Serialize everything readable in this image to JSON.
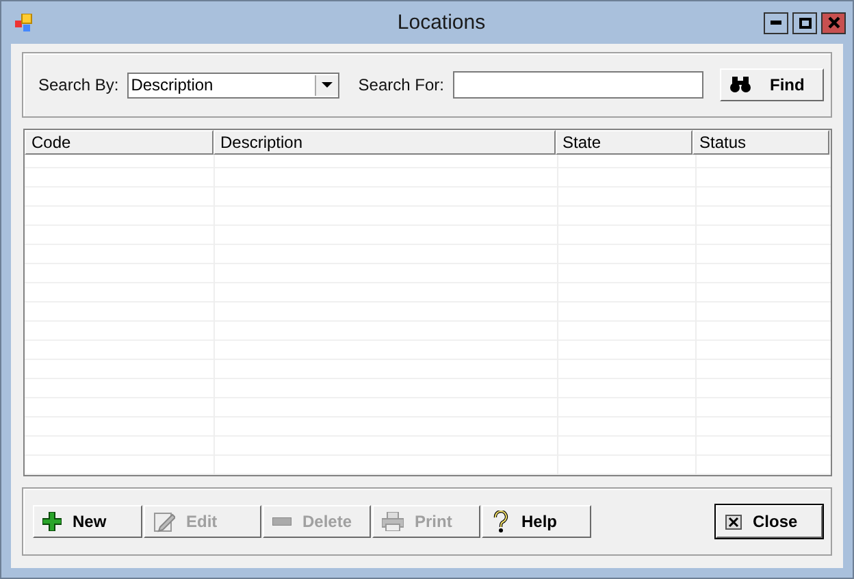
{
  "window": {
    "title": "Locations"
  },
  "search": {
    "by_label": "Search By:",
    "by_value": "Description",
    "for_label": "Search For:",
    "find_button": "Find"
  },
  "table": {
    "columns": [
      "Code",
      "Description",
      "State",
      "Status"
    ]
  },
  "buttons": [
    {
      "label": "New",
      "kind": "new",
      "disabled": false
    },
    {
      "label": "Edit",
      "kind": "edit",
      "disabled": true
    },
    {
      "label": "Delete",
      "kind": "delete",
      "disabled": true
    },
    {
      "label": "Print",
      "kind": "print",
      "disabled": true
    },
    {
      "label": "Help",
      "kind": "help",
      "disabled": false
    }
  ],
  "close_button": "Close"
}
